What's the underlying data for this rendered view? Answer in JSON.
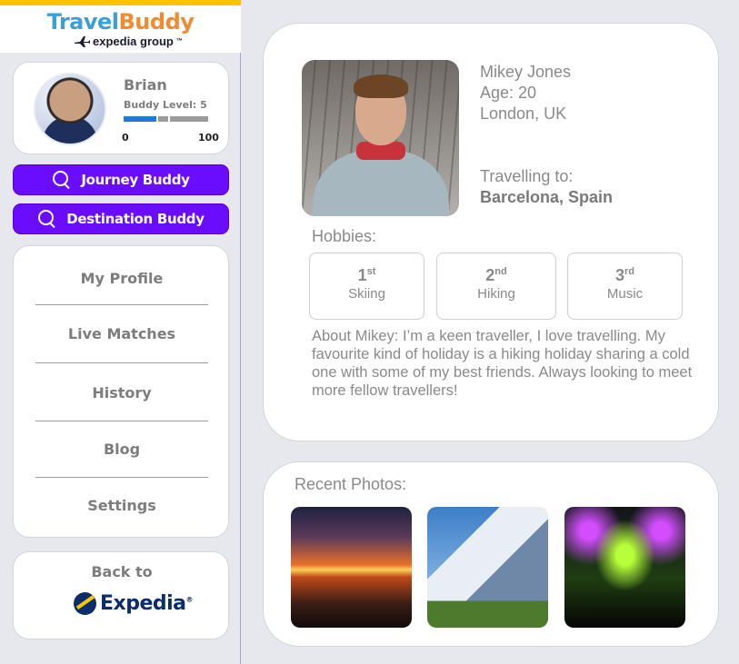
{
  "brand": {
    "name_part1": "Travel",
    "name_part2": "Buddy",
    "sub": "expedia group",
    "sub_tm": "™"
  },
  "user": {
    "name": "Brian",
    "buddy_level_label": "Buddy Level: 5",
    "level_min": "0",
    "level_max": "100",
    "level_progress": 0.5
  },
  "actions": {
    "journey_buddy": "Journey Buddy",
    "destination_buddy": "Destination Buddy"
  },
  "menu": {
    "items": [
      {
        "label": "My Profile"
      },
      {
        "label": "Live Matches"
      },
      {
        "label": "History"
      },
      {
        "label": "Blog"
      },
      {
        "label": "Settings"
      }
    ]
  },
  "back": {
    "label": "Back to",
    "brand": "Expedia",
    "tm": "®"
  },
  "profile": {
    "name": "Mikey Jones",
    "age": "Age: 20",
    "location": "London, UK",
    "travelling_label": "Travelling to:",
    "destination": "Barcelona, Spain",
    "hobbies_label": "Hobbies:",
    "hobbies": [
      {
        "rank": "1",
        "suffix": "st",
        "name": "Skiing"
      },
      {
        "rank": "2",
        "suffix": "nd",
        "name": "Hiking"
      },
      {
        "rank": "3",
        "suffix": "rd",
        "name": "Music"
      }
    ],
    "about": "About Mikey: I’m a keen traveller, I love travelling. My favourite kind of holiday is a hiking holiday sharing a cold one with some of my best friends. Always looking to meet more fellow travellers!"
  },
  "photos": {
    "label": "Recent Photos:"
  },
  "colors": {
    "accent_purple": "#6a0dff",
    "brand_yellow": "#f7c600",
    "level_blue": "#1f7ad0",
    "level_grey": "#9b9b9b"
  }
}
